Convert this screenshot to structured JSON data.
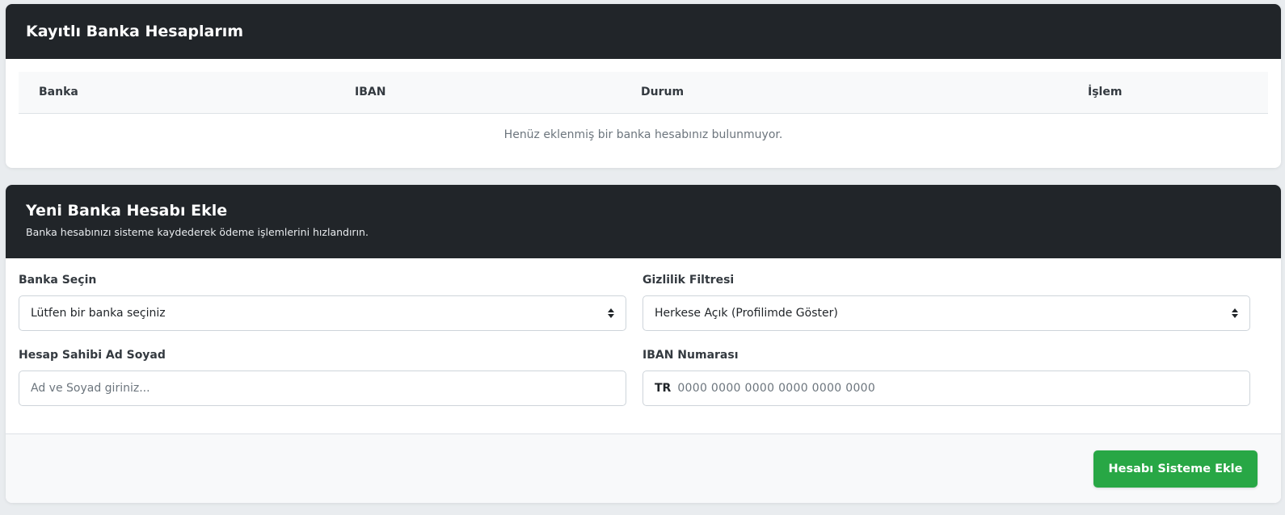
{
  "saved_accounts": {
    "title": "Kayıtlı Banka Hesaplarım",
    "columns": [
      "Banka",
      "IBAN",
      "Durum",
      "İşlem"
    ],
    "empty_message": "Henüz eklenmiş bir banka hesabınız bulunmuyor."
  },
  "new_account": {
    "title": "Yeni Banka Hesabı Ekle",
    "subtitle": "Banka hesabınızı sisteme kaydederek ödeme işlemlerini hızlandırın.",
    "bank_select": {
      "label": "Banka Seçin",
      "value": "Lütfen bir banka seçiniz"
    },
    "privacy_select": {
      "label": "Gizlilik Filtresi",
      "value": "Herkese Açık (Profilimde Göster)"
    },
    "holder_name": {
      "label": "Hesap Sahibi Ad Soyad",
      "placeholder": "Ad ve Soyad giriniz..."
    },
    "iban": {
      "label": "IBAN Numarası",
      "prefix": "TR",
      "placeholder": "0000 0000 0000 0000 0000 0000"
    },
    "submit_label": "Hesabı Sisteme Ekle"
  },
  "colors": {
    "header_bg": "#212529",
    "submit_bg": "#28a745",
    "page_bg": "#e9ecef"
  }
}
